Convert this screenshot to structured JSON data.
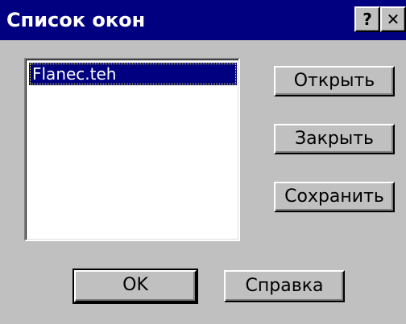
{
  "window": {
    "title": "Список окон",
    "help_button_label": "?",
    "close_button_label": "✕"
  },
  "list": {
    "items": [
      {
        "label": "Flanec.teh",
        "selected": true
      }
    ]
  },
  "buttons": {
    "open": "Открыть",
    "close": "Закрыть",
    "save": "Сохранить",
    "ok": "OK",
    "help": "Справка"
  },
  "colors": {
    "titlebar": "#000080",
    "selection": "#000080",
    "face": "#c0c0c0"
  }
}
